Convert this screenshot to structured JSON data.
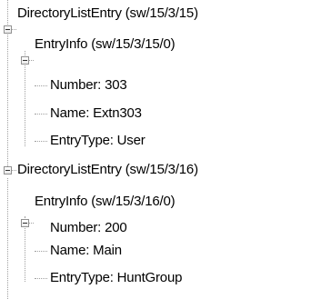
{
  "tree": {
    "entries": [
      {
        "label": "DirectoryListEntry (sw/15/3/15)",
        "info_label": "EntryInfo (sw/15/3/15/0)",
        "number": "Number: 303",
        "name": "Name: Extn303",
        "type": "EntryType: User"
      },
      {
        "label": "DirectoryListEntry (sw/15/3/16)",
        "info_label": "EntryInfo (sw/15/3/16/0)",
        "number": "Number: 200",
        "name": "Name: Main",
        "type": "EntryType: HuntGroup"
      }
    ]
  }
}
